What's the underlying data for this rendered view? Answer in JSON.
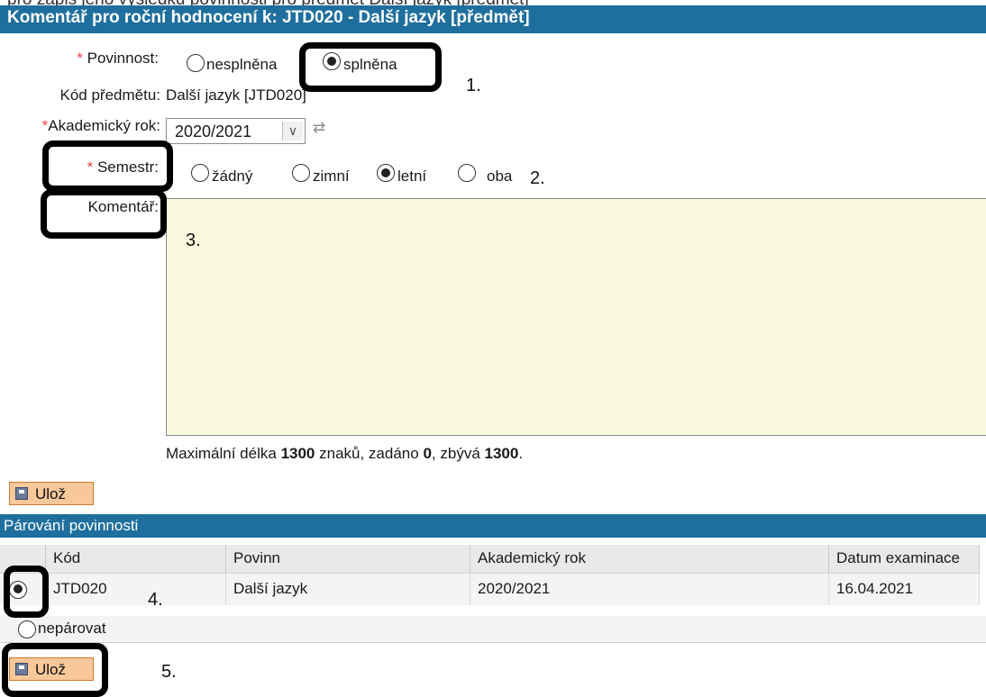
{
  "top_fragment": "pro zápis jeho výsledku povinnosti pro předmět Další jazyk [předmět]",
  "title": "Komentář pro roční hodnocení k: JTD020 - Další jazyk [předmět]",
  "form": {
    "povinnost": {
      "label": "Povinnost:",
      "required_mark": "*",
      "options": [
        {
          "label": "nesplněna",
          "checked": false
        },
        {
          "label": "splněna",
          "checked": true
        }
      ]
    },
    "kod": {
      "label": "Kód předmětu:",
      "value": "Další jazyk [JTD020]"
    },
    "akademicky_rok": {
      "label": "Akademický rok:",
      "required_mark": "*",
      "value": "2020/2021",
      "dropdown_glyph": "∨",
      "swap_icon": "⇄"
    },
    "semestr": {
      "label": "Semestr:",
      "required_mark": "*",
      "options": [
        {
          "label": "žádný",
          "checked": false
        },
        {
          "label": "zimní",
          "checked": false
        },
        {
          "label": "letní",
          "checked": true
        },
        {
          "label": "oba",
          "checked": false
        }
      ]
    },
    "komentar": {
      "label": "Komentář:",
      "value": ""
    },
    "max_length": {
      "prefix": "Maximální délka",
      "max": "1300",
      "mid": "znaků, zadáno",
      "entered": "0",
      "rest": ", zbývá",
      "remaining": "1300",
      "end": "."
    }
  },
  "save_button": {
    "label": "Ulož"
  },
  "pairing": {
    "title": "Párování povinnosti",
    "columns": [
      "Kód",
      "Povinn",
      "Akademický rok",
      "Datum examinace"
    ],
    "rows": [
      {
        "kod": "JTD020",
        "povinnost": "Další jazyk",
        "rok": "2020/2021",
        "datum": "16.04.2021",
        "selected": true
      }
    ],
    "unpair_label": "nepárovat"
  },
  "annotations": [
    "1.",
    "2.",
    "3.",
    "4.",
    "5."
  ],
  "colors": {
    "header_blue": "#1e6f9e",
    "textarea_bg": "#f8f8dc",
    "button_bg": "#f8c79a",
    "required": "#e8424a"
  }
}
